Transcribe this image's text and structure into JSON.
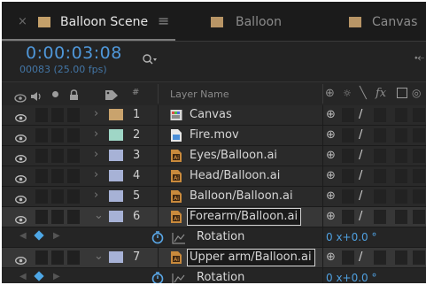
{
  "tabs": [
    {
      "label": "Balloon Scene",
      "swatch": "#c4a06a",
      "active": true
    },
    {
      "label": "Balloon",
      "swatch": "#b89566",
      "active": false
    },
    {
      "label": "Canvas",
      "swatch": "#b89566",
      "active": false
    }
  ],
  "tab_close_glyph": "×",
  "tab_menu_glyph": "≡",
  "timecode": "0:00:03:08",
  "frame_info": "00083 (25.00 fps)",
  "search": {
    "placeholder": ""
  },
  "columns": {
    "number_header": "#",
    "layer_name_header": "Layer Name"
  },
  "layers": [
    {
      "num": "1",
      "name": "Canvas",
      "label_color": "#c9a36d",
      "file_type": "composition",
      "expanded": false,
      "selected": false,
      "parent_glyph": "⊕",
      "switch_glyph": "/"
    },
    {
      "num": "2",
      "name": "Fire.mov",
      "label_color": "#9fd6c6",
      "file_type": "video",
      "expanded": false,
      "selected": false,
      "parent_glyph": "⊕",
      "switch_glyph": "/"
    },
    {
      "num": "3",
      "name": "Eyes/Balloon.ai",
      "label_color": "#a7b2d6",
      "file_type": "illustrator",
      "expanded": false,
      "selected": false,
      "parent_glyph": "⊕",
      "switch_glyph": "/"
    },
    {
      "num": "4",
      "name": "Head/Balloon.ai",
      "label_color": "#a7b2d6",
      "file_type": "illustrator",
      "expanded": false,
      "selected": false,
      "parent_glyph": "⊕",
      "switch_glyph": "/"
    },
    {
      "num": "5",
      "name": "Balloon/Balloon.ai",
      "label_color": "#a7b2d6",
      "file_type": "illustrator",
      "expanded": false,
      "selected": false,
      "parent_glyph": "⊕",
      "switch_glyph": "/"
    },
    {
      "num": "6",
      "name": "Forearm/Balloon.ai",
      "label_color": "#a7b2d6",
      "file_type": "illustrator",
      "expanded": true,
      "selected": true,
      "parent_glyph": "⊕",
      "switch_glyph": "/",
      "property": {
        "label": "Rotation",
        "value": "0 x+0.0 °"
      }
    },
    {
      "num": "7",
      "name": "Upper arm/Balloon.ai",
      "label_color": "#a7b2d6",
      "file_type": "illustrator",
      "expanded": true,
      "selected": true,
      "parent_glyph": "⊕",
      "switch_glyph": "/",
      "property": {
        "label": "Rotation",
        "value": "0 x+0.0 °"
      }
    }
  ],
  "colors": {
    "accent_blue": "#4f97d9",
    "keyframe_blue": "#4ea7e6"
  }
}
